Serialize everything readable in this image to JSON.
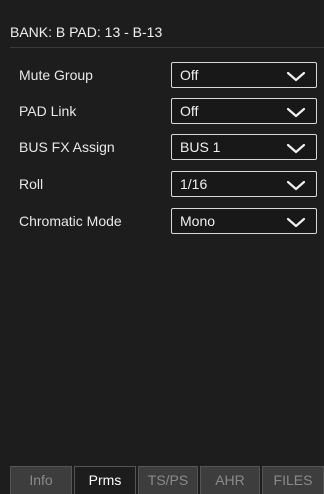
{
  "header": {
    "title": "BANK: B PAD: 13 - B-13"
  },
  "params": [
    {
      "label": "Mute Group",
      "value": "Off",
      "icon": "chevron-down-icon"
    },
    {
      "label": "PAD Link",
      "value": "Off",
      "icon": "chevron-down-icon"
    },
    {
      "label": "BUS FX Assign",
      "value": "BUS 1",
      "icon": "chevron-down-icon"
    },
    {
      "label": "Roll",
      "value": "1/16",
      "icon": "chevron-down-icon"
    },
    {
      "label": "Chromatic Mode",
      "value": "Mono",
      "icon": "chevron-down-icon"
    }
  ],
  "tabs": [
    {
      "label": "Info",
      "active": false
    },
    {
      "label": "Prms",
      "active": true
    },
    {
      "label": "TS/PS",
      "active": false
    },
    {
      "label": "AHR",
      "active": false
    },
    {
      "label": "FILES",
      "active": false
    }
  ],
  "colors": {
    "background": "#1d1d1d",
    "tab_inactive": "#3d3d3d",
    "select_border": "#d8d8d8"
  }
}
